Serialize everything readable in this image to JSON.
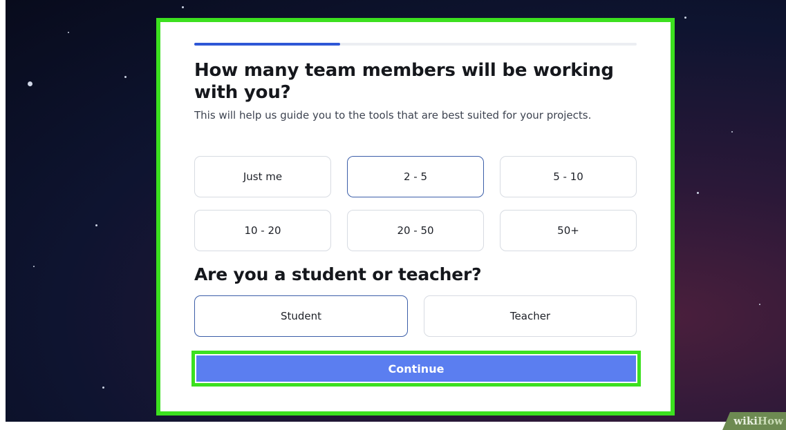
{
  "question1": {
    "title": "How many team members will be working with you?",
    "subtitle": "This will help us guide you to the tools that are best suited for your projects.",
    "progress_fraction": 0.33,
    "options": [
      {
        "label": "Just me",
        "selected": false
      },
      {
        "label": "2 - 5",
        "selected": true
      },
      {
        "label": "5 - 10",
        "selected": false
      },
      {
        "label": "10 - 20",
        "selected": false
      },
      {
        "label": "20 - 50",
        "selected": false
      },
      {
        "label": "50+",
        "selected": false
      }
    ]
  },
  "question2": {
    "title": "Are you a student or teacher?",
    "options": [
      {
        "label": "Student",
        "selected": true
      },
      {
        "label": "Teacher",
        "selected": false
      }
    ]
  },
  "continue_label": "Continue",
  "watermark": {
    "wiki": "wiki",
    "how": "How"
  },
  "colors": {
    "highlight": "#3ce01f",
    "primary_button": "#5b7ef0",
    "progress": "#2e57d6",
    "selected_border": "#3a5da8"
  }
}
